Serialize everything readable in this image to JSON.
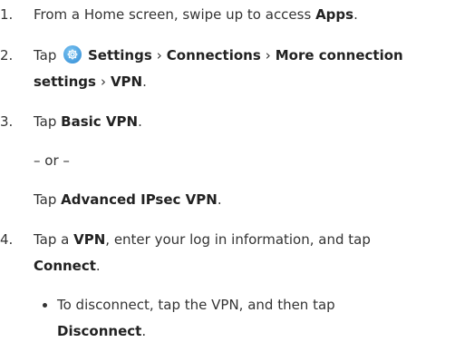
{
  "steps": [
    {
      "number": "1.",
      "prefix": "From a Home screen, swipe up to access ",
      "bold": "Apps",
      "suffix": "."
    },
    {
      "number": "2.",
      "tap": "Tap",
      "settings": "Settings",
      "sep": "›",
      "connections": "Connections",
      "more1": "More connection",
      "more2": "settings",
      "vpn": "VPN",
      "end": "."
    },
    {
      "number": "3.",
      "prefix": "Tap ",
      "bold": "Basic VPN",
      "suffix": "."
    },
    {
      "or": "– or –"
    },
    {
      "prefix": "Tap ",
      "bold": "Advanced IPsec VPN",
      "suffix": "."
    },
    {
      "number": "4.",
      "prefix": "Tap a ",
      "bold": "VPN",
      "middle": ", enter your log in information, and tap",
      "bold2": "Connect",
      "suffix": "."
    }
  ],
  "bullet": {
    "prefix": "To disconnect, tap the VPN, and then tap",
    "bold": "Disconnect",
    "suffix": "."
  },
  "icons": {
    "settings": "settings-gear-icon",
    "bullet": "bullet-dot-icon"
  },
  "colors": {
    "text": "#333333",
    "settings_icon": "#2d89d4"
  }
}
